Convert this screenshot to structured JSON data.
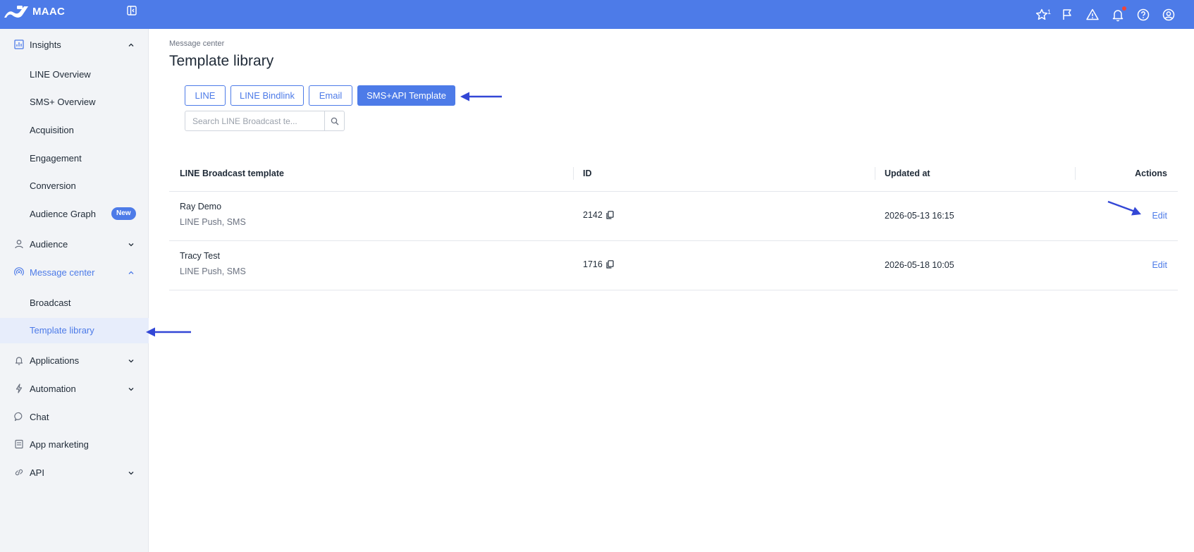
{
  "app": {
    "name": "MAAC"
  },
  "colors": {
    "primary": "#4d7be8",
    "sidebar_bg": "#f2f4f7",
    "selected_bg": "#e7edfb",
    "annotation_arrow": "#3347d6",
    "notification_dot": "#f04438"
  },
  "header": {
    "icons": [
      "star-icon",
      "flag-icon",
      "warning-icon",
      "bell-icon",
      "help-icon",
      "user-icon"
    ],
    "star_badge": "1"
  },
  "sidebar": {
    "insights": {
      "label": "Insights",
      "icon": "chart-icon"
    },
    "insights_items": [
      "LINE Overview",
      "SMS+ Overview",
      "Acquisition",
      "Engagement",
      "Conversion",
      "Audience Graph"
    ],
    "new_badge": "New",
    "audience": {
      "label": "Audience",
      "icon": "person-icon"
    },
    "message_center": {
      "label": "Message center",
      "icon": "broadcast-icon"
    },
    "message_items": [
      "Broadcast",
      "Template library"
    ],
    "applications": {
      "label": "Applications",
      "icon": "bell-icon"
    },
    "automation": {
      "label": "Automation",
      "icon": "lightning-icon"
    },
    "chat": {
      "label": "Chat",
      "icon": "chat-bubble-icon"
    },
    "app_marketing": {
      "label": "App marketing",
      "icon": "app-icon"
    },
    "api": {
      "label": "API",
      "icon": "link-icon"
    }
  },
  "main": {
    "breadcrumb": "Message center",
    "title": "Template library",
    "tabs": [
      "LINE",
      "LINE Bindlink",
      "Email",
      "SMS+API Template"
    ],
    "active_tab": "SMS+API Template",
    "search": {
      "placeholder": "Search LINE Broadcast te..."
    },
    "table": {
      "columns": [
        "LINE Broadcast template",
        "ID",
        "Updated at",
        "Actions"
      ],
      "rows": [
        {
          "name": "Ray Demo",
          "channels": "LINE Push, SMS",
          "id": "2142",
          "updated": "2026-05-13 16:15",
          "action": "Edit"
        },
        {
          "name": "Tracy Test",
          "channels": "LINE Push, SMS",
          "id": "1716",
          "updated": "2026-05-18 10:05",
          "action": "Edit"
        }
      ]
    }
  }
}
